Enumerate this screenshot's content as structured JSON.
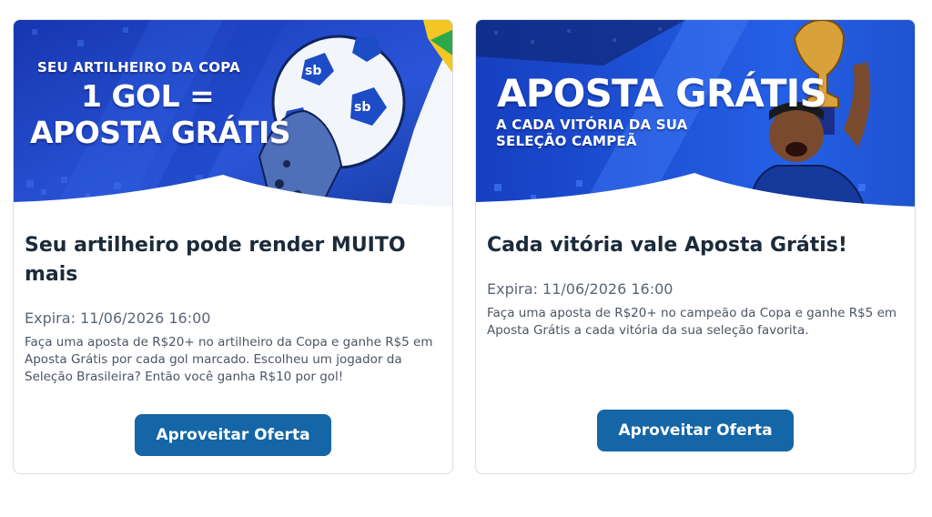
{
  "offers": [
    {
      "banner": {
        "kicker": "SEU ARTILHEIRO DA COPA",
        "line1": "1 GOL =",
        "line2": "APOSTA GRÁTIS",
        "logo": "sb"
      },
      "title": "Seu artilheiro pode render MUITO mais",
      "expiry": "Expira: 11/06/2026 16:00",
      "description": "Faça uma aposta de R$20+ no artilheiro da Copa e ganhe R$5 em Aposta Grátis por cada gol marcado. Escolheu um jogador da Seleção Brasileira? Então você ganha R$10 por gol!",
      "cta_label": "Aproveitar Oferta"
    },
    {
      "banner": {
        "title": "APOSTA GRÁTIS",
        "sub1": "A CADA VITÓRIA DA SUA",
        "sub2": "SELEÇÃO CAMPEÃ"
      },
      "title": "Cada vitória vale Aposta Grátis!",
      "expiry": "Expira: 11/06/2026 16:00",
      "description": "Faça uma aposta de R$20+ no campeão da Copa e ganhe R$5 em Aposta Grátis a cada vitória da sua seleção favorita.",
      "cta_label": "Aproveitar Oferta"
    }
  ],
  "colors": {
    "banner_blue": "#1d47c9",
    "banner_dark": "#0f2a86",
    "cta_blue": "#1466a6",
    "title_text": "#1c2b3a"
  }
}
